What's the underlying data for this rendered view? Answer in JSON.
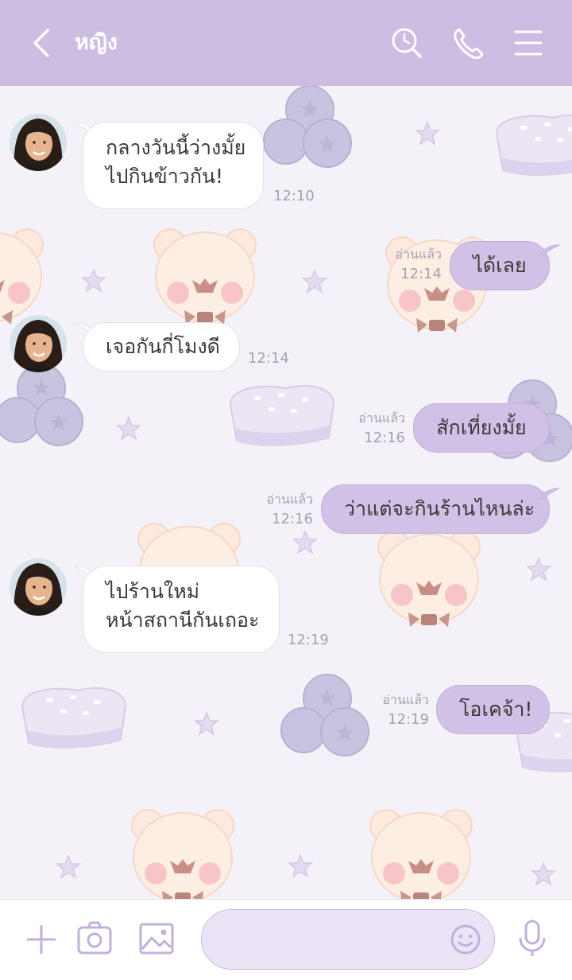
{
  "header": {
    "contact_name": "หญิง",
    "icons": [
      "back-arrow-icon",
      "search-icon",
      "phone-icon",
      "menu-icon"
    ]
  },
  "messages": [
    {
      "side": "in",
      "lines": [
        "กลางวันนี้ว่างมั้ย",
        "ไปกินข้าวกัน!"
      ],
      "time": "12:10"
    },
    {
      "side": "out",
      "text": "ได้เลย",
      "read": "อ่านแล้ว",
      "time": "12:14"
    },
    {
      "side": "in",
      "lines": [
        "เจอกันกี่โมงดี"
      ],
      "time": "12:14"
    },
    {
      "side": "out",
      "text": "สักเที่ยงมั้ย",
      "read": "อ่านแล้ว",
      "time": "12:16"
    },
    {
      "side": "out",
      "text": "ว่าแต่จะกินร้านไหนล่ะ",
      "read": "อ่านแล้ว",
      "time": "12:16"
    },
    {
      "side": "in",
      "lines": [
        "ไปร้านใหม่",
        "หน้าสถานีกันเถอะ"
      ],
      "time": "12:19"
    },
    {
      "side": "out",
      "text": "โอเคจ้า!",
      "read": "อ่านแล้ว",
      "time": "12:19"
    }
  ],
  "input": {
    "value": "",
    "placeholder": ""
  },
  "colors": {
    "header_bg": "#cdbde3",
    "outgoing_bubble": "#d2c1e6",
    "incoming_bubble": "#ffffff",
    "chat_bg": "#f5f1f8"
  },
  "bottom_icons": [
    "plus-icon",
    "camera-icon",
    "image-icon",
    "emoji-icon",
    "microphone-icon"
  ]
}
